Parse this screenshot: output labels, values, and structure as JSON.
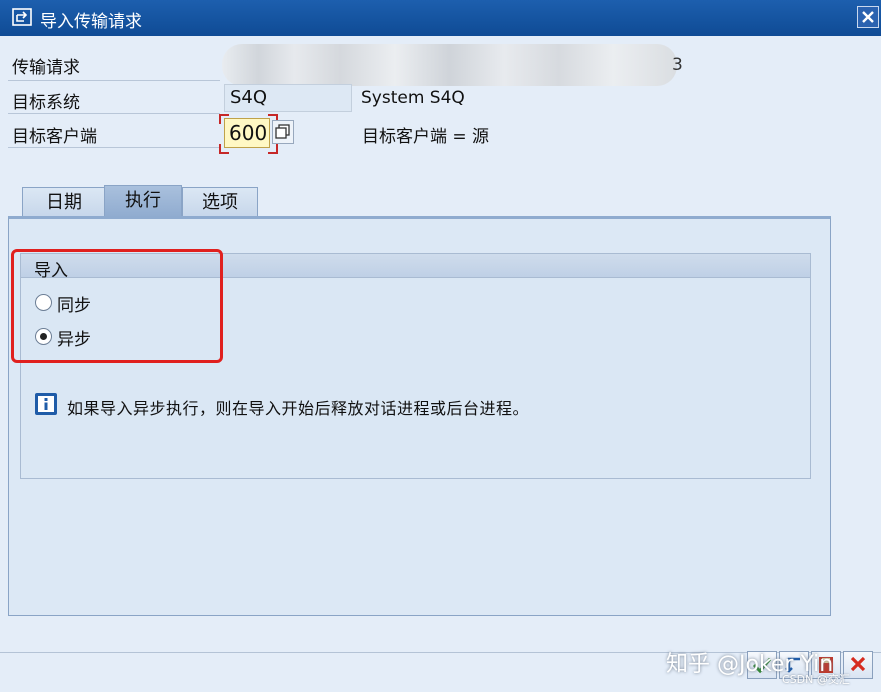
{
  "window": {
    "title": "导入传输请求",
    "close_icon": "close-icon",
    "title_icon": "import-icon"
  },
  "fields": {
    "transport_request": {
      "label": "传输请求",
      "value_visible_tail": "3"
    },
    "target_system": {
      "label": "目标系统",
      "value": "S4Q",
      "description": "System S4Q"
    },
    "target_client": {
      "label": "目标客户端",
      "value": "600",
      "description": "目标客户端 = 源"
    }
  },
  "tabs": [
    {
      "label": "日期",
      "active": false
    },
    {
      "label": "执行",
      "active": true
    },
    {
      "label": "选项",
      "active": false
    }
  ],
  "import_group": {
    "title": "导入",
    "options": [
      {
        "label": "同步",
        "selected": false
      },
      {
        "label": "异步",
        "selected": true
      }
    ]
  },
  "info": {
    "text": "如果导入异步执行，则在导入开始后释放对话进程或后台进程。"
  },
  "footer": {
    "watermark": "知乎 @Joker Yin",
    "watermark_small": "CSDN @交汇",
    "buttons": [
      "confirm-icon",
      "back-icon",
      "save-icon",
      "cancel-icon"
    ]
  },
  "colors": {
    "title_bar": "#1d5fae",
    "highlight": "#e0201e",
    "input_active": "#fff8c4"
  }
}
